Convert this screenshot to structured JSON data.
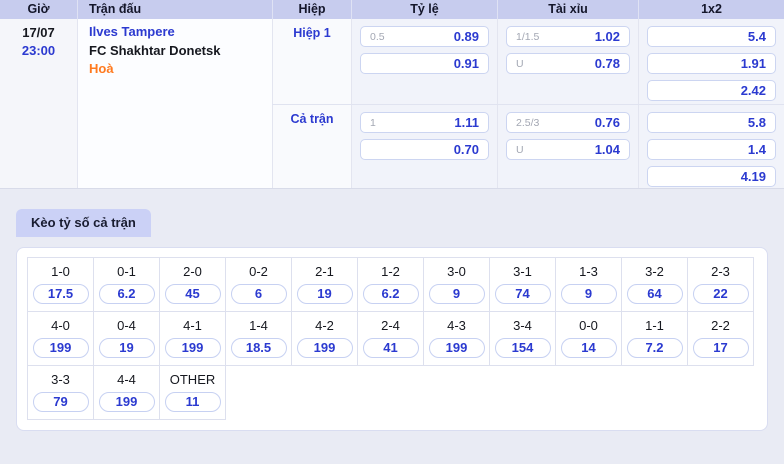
{
  "colors": {
    "header_bg": "#c7ccee",
    "odds_blue": "#2b3ad0",
    "link_blue": "#2c3ad0",
    "draw_orange": "#ff7a1f",
    "tab_bg": "#cbd1f6",
    "page_bg": "#e9ebf4"
  },
  "odds_table": {
    "headers": {
      "time": "Giờ",
      "match": "Trận đấu",
      "period": "Hiệp",
      "rate": "Tỷ lệ",
      "over_under": "Tài xỉu",
      "one_x_two": "1x2"
    },
    "match": {
      "date": "17/07",
      "time": "23:00",
      "home": "Ilves Tampere",
      "away": "FC Shakhtar Donetsk",
      "result": "Hoà"
    },
    "sections": [
      {
        "period": "Hiệp 1",
        "rate": [
          {
            "label": "0.5",
            "value": "0.89"
          },
          {
            "label": "",
            "value": "0.91"
          }
        ],
        "over_under": [
          {
            "label": "1/1.5",
            "value": "1.02"
          },
          {
            "label": "U",
            "value": "0.78"
          }
        ],
        "one_x_two": [
          "5.4",
          "1.91",
          "2.42"
        ]
      },
      {
        "period": "Cả trận",
        "rate": [
          {
            "label": "1",
            "value": "1.11"
          },
          {
            "label": "",
            "value": "0.70"
          }
        ],
        "over_under": [
          {
            "label": "2.5/3",
            "value": "0.76"
          },
          {
            "label": "U",
            "value": "1.04"
          }
        ],
        "one_x_two": [
          "5.8",
          "1.4",
          "4.19"
        ]
      }
    ]
  },
  "score_section": {
    "tab_label": "Kèo tỷ số cả trận",
    "rows": [
      [
        {
          "score": "1-0",
          "odds": "17.5"
        },
        {
          "score": "0-1",
          "odds": "6.2"
        },
        {
          "score": "2-0",
          "odds": "45"
        },
        {
          "score": "0-2",
          "odds": "6"
        },
        {
          "score": "2-1",
          "odds": "19"
        },
        {
          "score": "1-2",
          "odds": "6.2"
        },
        {
          "score": "3-0",
          "odds": "9"
        },
        {
          "score": "3-1",
          "odds": "74"
        },
        {
          "score": "1-3",
          "odds": "9"
        },
        {
          "score": "3-2",
          "odds": "64"
        },
        {
          "score": "2-3",
          "odds": "22"
        }
      ],
      [
        {
          "score": "4-0",
          "odds": "199"
        },
        {
          "score": "0-4",
          "odds": "19"
        },
        {
          "score": "4-1",
          "odds": "199"
        },
        {
          "score": "1-4",
          "odds": "18.5"
        },
        {
          "score": "4-2",
          "odds": "199"
        },
        {
          "score": "2-4",
          "odds": "41"
        },
        {
          "score": "4-3",
          "odds": "199"
        },
        {
          "score": "3-4",
          "odds": "154"
        },
        {
          "score": "0-0",
          "odds": "14"
        },
        {
          "score": "1-1",
          "odds": "7.2"
        },
        {
          "score": "2-2",
          "odds": "17"
        }
      ],
      [
        {
          "score": "3-3",
          "odds": "79"
        },
        {
          "score": "4-4",
          "odds": "199"
        },
        {
          "score": "OTHER",
          "odds": "11"
        }
      ]
    ]
  }
}
